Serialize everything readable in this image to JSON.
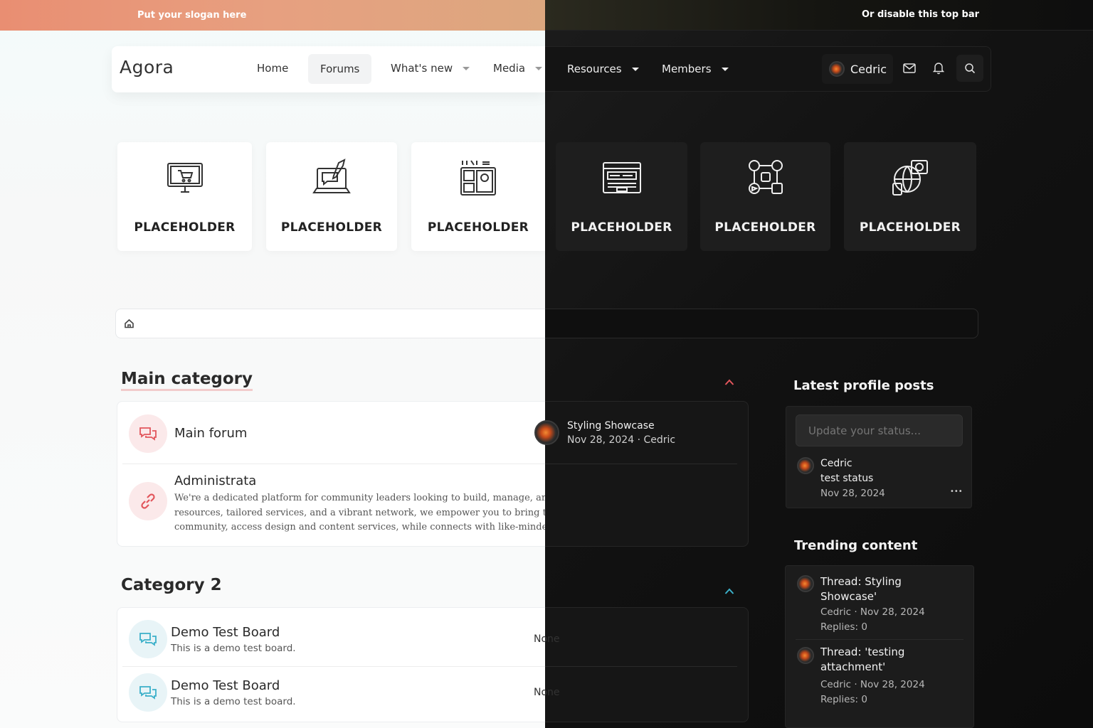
{
  "topbar": {
    "slogan": "Put your slogan here",
    "right_text": "Or disable this top bar"
  },
  "nav": {
    "logo": "Agora",
    "items": [
      {
        "label": "Home"
      },
      {
        "label": "Forums"
      },
      {
        "label": "What's new"
      },
      {
        "label": "Media"
      },
      {
        "label": "Resources"
      },
      {
        "label": "Members"
      }
    ],
    "user": "Cedric"
  },
  "tiles": [
    {
      "label": "PLACEHOLDER",
      "icon": "computer-cart-icon"
    },
    {
      "label": "PLACEHOLDER",
      "icon": "laptop-chat-icon"
    },
    {
      "label": "PLACEHOLDER",
      "icon": "web-layout-icon"
    },
    {
      "label": "PLACEHOLDER",
      "icon": "browser-window-icon"
    },
    {
      "label": "PLACEHOLDER",
      "icon": "network-icon"
    },
    {
      "label": "PLACEHOLDER",
      "icon": "global-media-icon"
    }
  ],
  "main_category": {
    "title": "Main category",
    "forums": [
      {
        "title": "Main forum",
        "latest_title": "Styling Showcase",
        "latest_meta": "Nov 28, 2024 · Cedric"
      },
      {
        "title": "Administrata",
        "description_lines": [
          "We're a dedicated platform for community leaders looking to build, manage, and grow successful online communities,",
          "resources, tailored services, and a vibrant network, we empower you to bring the best of all you can offer at all, you can",
          "community, access design and content services, while connects with like-minded enthusiasts!"
        ]
      }
    ]
  },
  "category_2": {
    "title": "Category 2",
    "forums": [
      {
        "title": "Demo Test Board",
        "description": "This is a demo test board.",
        "latest": "None"
      },
      {
        "title": "Demo Test Board",
        "description": "This is a demo test board.",
        "latest": "None"
      }
    ]
  },
  "sidebar": {
    "profile_posts": {
      "title": "Latest profile posts",
      "status_placeholder": "Update your status...",
      "post": {
        "user": "Cedric",
        "text": "test status",
        "date": "Nov 28, 2024",
        "more": "•••"
      }
    },
    "trending": {
      "title": "Trending content",
      "items": [
        {
          "title_line1": "Thread: Styling",
          "title_line2": "Showcase'",
          "meta": "Cedric · Nov 28, 2024",
          "replies": "Replies: 0"
        },
        {
          "title_line1": "Thread: 'testing",
          "title_line2": "attachment'",
          "meta": "Cedric · Nov 28, 2024",
          "replies": "Replies: 0"
        }
      ]
    }
  },
  "colors": {
    "accent_red": "#e2565c",
    "accent_teal": "#3bb0c9",
    "topbar_gradient_start": "#e98e72",
    "dark_bg": "#0e0e0e"
  }
}
